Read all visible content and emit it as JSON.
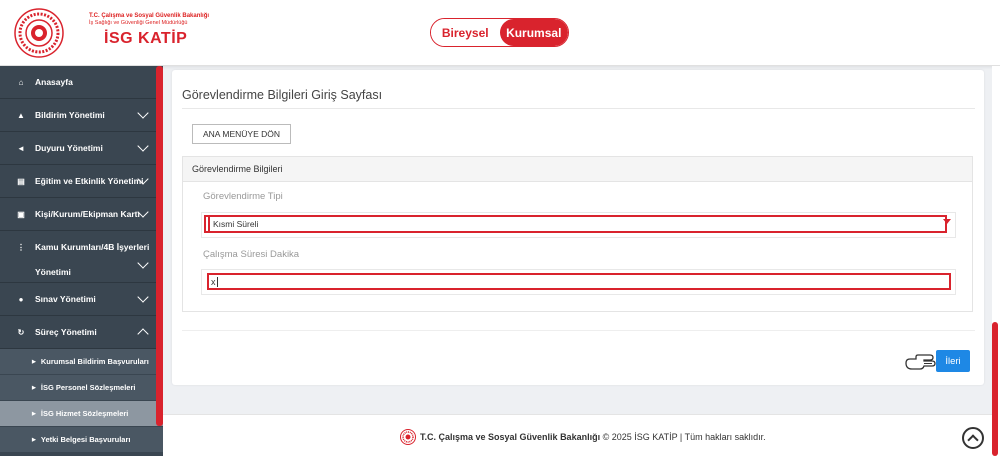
{
  "header": {
    "org_line1": "T.C. Çalışma ve Sosyal Güvenlik Bakanlığı",
    "org_line2": "İş Sağlığı ve Güvenliği Genel Müdürlüğü",
    "app_title": "İSG KATİP",
    "toggle": {
      "bireysel": "Bireysel",
      "kurumsal": "Kurumsal",
      "active": "Kurumsal"
    }
  },
  "sidebar": {
    "items": [
      {
        "label": "Anasayfa",
        "icon": "home-icon"
      },
      {
        "label": "Bildirim Yönetimi",
        "icon": "bell-icon"
      },
      {
        "label": "Duyuru Yönetimi",
        "icon": "megaphone-icon"
      },
      {
        "label": "Eğitim ve Etkinlik Yönetimi",
        "icon": "list-icon"
      },
      {
        "label": "Kişi/Kurum/Ekipman Kartı",
        "icon": "id-card-icon"
      },
      {
        "label": "Kamu Kurumları/4B İşyerleri Yönetimi",
        "label_line1": "Kamu Kurumları/4B İşyerleri",
        "label_line2": "Yönetimi",
        "icon": "sitemap-icon"
      },
      {
        "label": "Sınav Yönetimi",
        "icon": "users-icon"
      },
      {
        "label": "Süreç Yönetimi",
        "icon": "refresh-icon"
      }
    ],
    "sub_items": [
      {
        "label": "Kurumsal Bildirim Başvuruları"
      },
      {
        "label": "İSG Personel Sözleşmeleri"
      },
      {
        "label": "İSG Hizmet Sözleşmeleri",
        "active": true
      },
      {
        "label": "Yetki Belgesi Başvuruları"
      }
    ]
  },
  "main": {
    "page_title": "Görevlendirme Bilgileri Giriş Sayfası",
    "menu_button": "ANA MENÜYE DÖN",
    "section_title": "Görevlendirme Bilgileri",
    "fields": {
      "gorevlendirme_tipi": {
        "label": "Görevlendirme Tipi",
        "value": "Kısmi Süreli"
      },
      "calisma_suresi": {
        "label": "Çalışma Süresi Dakika",
        "value": "x"
      }
    },
    "next_button": "İleri"
  },
  "footer": {
    "org": "T.C. Çalışma ve Sosyal Güvenlik Bakanlığı",
    "rest": "© 2025 İSG KATİP | Tüm hakları saklıdır."
  },
  "colors": {
    "brand_red": "#d9232d",
    "sidebar_bg": "#3a4651",
    "next_blue": "#1e88e5"
  }
}
